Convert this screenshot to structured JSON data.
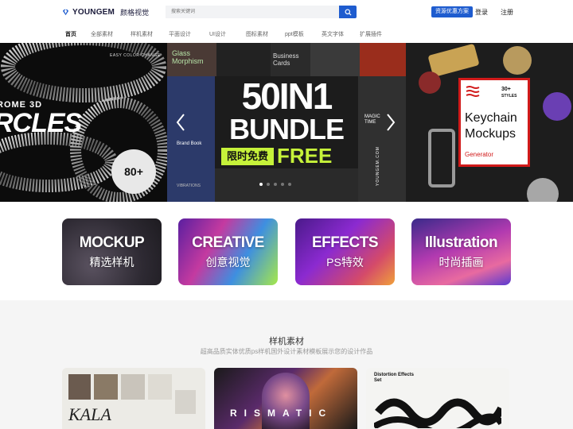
{
  "header": {
    "brand": "YOUNGEM",
    "brand_cn": "颜格视觉",
    "search_placeholder": "搜索关键词",
    "promo_label": "资源优惠方案",
    "login_label": "登录",
    "register_label": "注册",
    "accent": "#1e5ccf"
  },
  "nav": {
    "items": [
      {
        "label": "首页",
        "active": true
      },
      {
        "label": "全部素材"
      },
      {
        "label": "样机素材"
      },
      {
        "label": "平面设计"
      },
      {
        "label": "UI设计"
      },
      {
        "label": "图标素材"
      },
      {
        "label": "ppt模板"
      },
      {
        "label": "英文字体"
      },
      {
        "label": "扩展插件"
      }
    ]
  },
  "banner": {
    "left": {
      "tagline": "EASY COLOR CHANGE",
      "title_line1": "ROME 3D",
      "title_line2": "RCLES",
      "badge": "80+",
      "badge_ring": "SHAPES SHAPES SHAPES"
    },
    "center": {
      "tiles": [
        "Glass Morphism",
        "Business Cards",
        "Brand Book",
        "MAGIC TIME",
        "VIBRATIONS"
      ],
      "headline_line1": "50IN1",
      "headline_line2": "BUNDLE",
      "tag_cn": "限时免费",
      "tag_en": "FREE",
      "vertical_text": "YOUNGEM.COM"
    },
    "right": {
      "count": "30+",
      "count_sub": "STYLES",
      "title_line1": "Keychain",
      "title_line2": "Mockups",
      "sub": "Generator"
    },
    "dots": 5,
    "active_dot": 0
  },
  "features": [
    {
      "title": "MOCKUP",
      "sub": "精选样机"
    },
    {
      "title": "CREATIVE",
      "sub": "创意视觉"
    },
    {
      "title": "EFFECTS",
      "sub": "PS特效"
    },
    {
      "title": "Illustration",
      "sub": "时尚插画"
    }
  ],
  "section": {
    "title": "样机素材",
    "subtitle": "超高品质实体优质ps样机国外设计素材模板展示您的设计作品"
  },
  "thumbnails": [
    {
      "caption": "KALA"
    },
    {
      "caption": "RISMATIC"
    },
    {
      "caption": "Distortion Effects Set"
    }
  ]
}
